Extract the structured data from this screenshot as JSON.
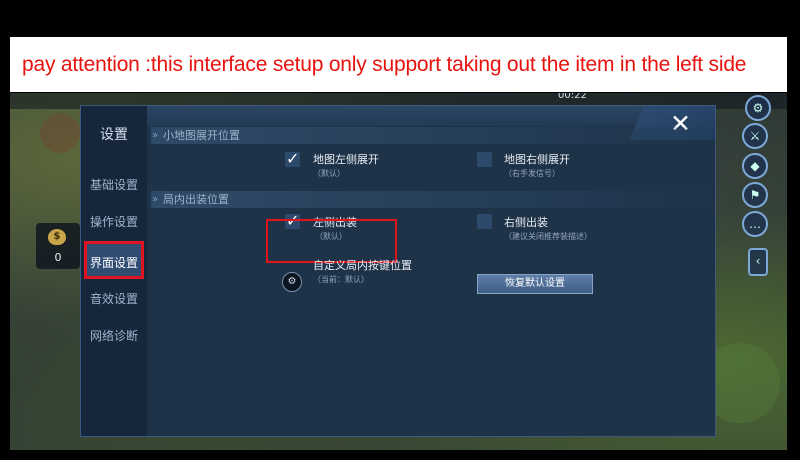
{
  "notice": {
    "text": "pay attention :this interface setup only support taking out the item in the left side"
  },
  "game_hud": {
    "timer": "00:22",
    "gold_count": "0",
    "coin_symbol": "$"
  },
  "colors": {
    "notice_text": "#e8130f",
    "highlight_border": "#e0141b",
    "panel_bg": "#1f3348",
    "active_tab_bg": "#2f4c73"
  },
  "settings": {
    "title": "设置",
    "tabs": [
      {
        "label": "基础设置",
        "active": false
      },
      {
        "label": "操作设置",
        "active": false
      },
      {
        "label": "界面设置",
        "active": true
      },
      {
        "label": "音效设置",
        "active": false
      },
      {
        "label": "网络诊断",
        "active": false
      }
    ],
    "close_icon": "close-icon",
    "sections": [
      {
        "title": "小地图展开位置",
        "options": [
          {
            "label": "地图左侧展开",
            "sub": "（默认）",
            "checked": true
          },
          {
            "label": "地图右侧展开",
            "sub": "（右手发信号）",
            "checked": false
          }
        ]
      },
      {
        "title": "局内出装位置",
        "options": [
          {
            "label": "左侧出装",
            "sub": "（默认）",
            "checked": true
          },
          {
            "label": "右侧出装",
            "sub": "（建议关闭推荐装描述）",
            "checked": false
          }
        ]
      }
    ],
    "custom_layout": {
      "label": "自定义局内按键位置",
      "sub": "（当前：默认）",
      "reset_button": "恢复默认设置"
    }
  }
}
